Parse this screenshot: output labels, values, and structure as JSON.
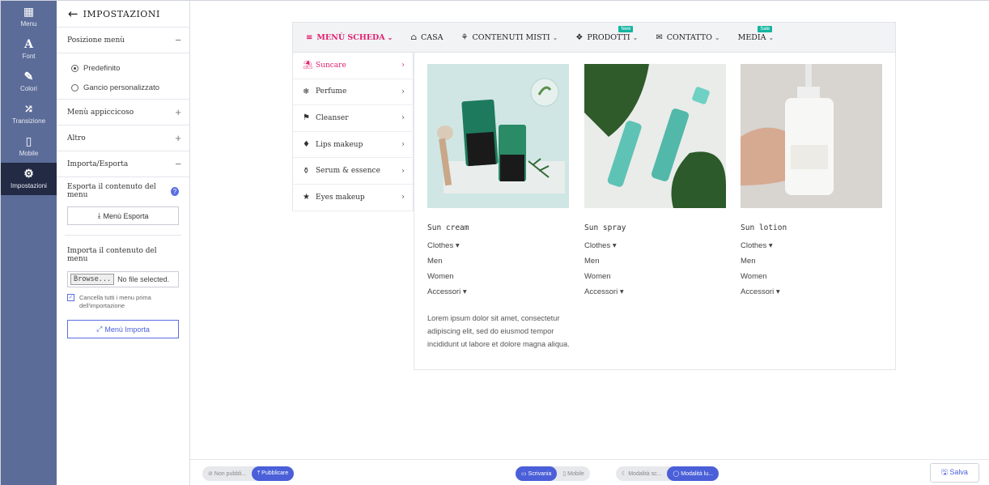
{
  "rail": {
    "items": [
      {
        "icon": "▦",
        "label": "Menu"
      },
      {
        "icon": "A",
        "label": "Font"
      },
      {
        "icon": "✎",
        "label": "Colori"
      },
      {
        "icon": "⤮",
        "label": "Transizione"
      },
      {
        "icon": "▯",
        "label": "Mobile"
      },
      {
        "icon": "⚙",
        "label": "Impostazioni"
      }
    ]
  },
  "panel": {
    "title": "IMPOSTAZIONI",
    "back_icon": "←",
    "position": {
      "title": "Posizione menù",
      "toggle": "−",
      "options": [
        "Predefinito",
        "Gancio personalizzato"
      ]
    },
    "sticky": {
      "title": "Menù appiccicoso",
      "toggle": "+"
    },
    "other": {
      "title": "Altro",
      "toggle": "+"
    },
    "import_export": {
      "title": "Importa/Esporta",
      "toggle": "−",
      "export_label": "Esporta il contenuto del menu",
      "info_icon": "?",
      "export_button": "Menù Esporta",
      "export_icon": "⤓",
      "import_label": "Importa il contenuto del menu",
      "browse_button": "Browse...",
      "file_status": "No file selected.",
      "clear_check": "✓",
      "clear_label": "Cancella tutti i menu prima dell'importazione",
      "import_button": "Menù Importa",
      "import_icon": "⤢"
    }
  },
  "menubar": {
    "items": [
      {
        "icon": "≡",
        "label": "MENÙ SCHEDA",
        "chevron": "⌄",
        "badge": ""
      },
      {
        "icon": "⌂",
        "label": "CASA",
        "chevron": "",
        "badge": ""
      },
      {
        "icon": "⚘",
        "label": "CONTENUTI MISTI",
        "chevron": "⌄",
        "badge": ""
      },
      {
        "icon": "❖",
        "label": "PRODOTTI",
        "chevron": "⌄",
        "badge": "New"
      },
      {
        "icon": "✉",
        "label": "CONTATTO",
        "chevron": "⌄",
        "badge": ""
      },
      {
        "icon": "",
        "label": "MEDIA",
        "chevron": "⌄",
        "badge": "Sale"
      }
    ]
  },
  "categories": [
    {
      "icon": "⛱",
      "label": "Suncare",
      "arrow": "›"
    },
    {
      "icon": "❄",
      "label": "Perfume",
      "arrow": "›"
    },
    {
      "icon": "⚑",
      "label": "Cleanser",
      "arrow": "›"
    },
    {
      "icon": "♦",
      "label": "Lips makeup",
      "arrow": "›"
    },
    {
      "icon": "⚱",
      "label": "Serum & essence",
      "arrow": "›"
    },
    {
      "icon": "★",
      "label": "Eyes makeup",
      "arrow": "›"
    }
  ],
  "products": [
    {
      "title": "Sun cream",
      "links": [
        "Clothes ▾",
        "Men",
        "Women",
        "Accessori ▾"
      ]
    },
    {
      "title": "Sun spray",
      "links": [
        "Clothes ▾",
        "Men",
        "Women",
        "Accessori ▾"
      ]
    },
    {
      "title": "Sun lotion",
      "links": [
        "Clothes ▾",
        "Men",
        "Women",
        "Accessori ▾"
      ]
    }
  ],
  "lorem": "Lorem ipsum dolor sit amet, consectetur adipiscing elit, sed do eiusmod tempor incididunt ut labore et dolore magna aliqua.",
  "bottombar": {
    "publish": {
      "off": "⊘ Non pubbli...",
      "on": "⤒ Pubblicare"
    },
    "device": {
      "desktop": "▭ Scrivania",
      "mobile": "▯ Mobile"
    },
    "mode": {
      "dark": "☾ Modalità sc...",
      "light": "◯ Modalità lu..."
    },
    "save": "🖫 Salva"
  },
  "colors": {
    "accent": "#e02070",
    "primary": "#4a5fd8",
    "rail": "#5c6c99",
    "badge": "#13b5a0"
  }
}
